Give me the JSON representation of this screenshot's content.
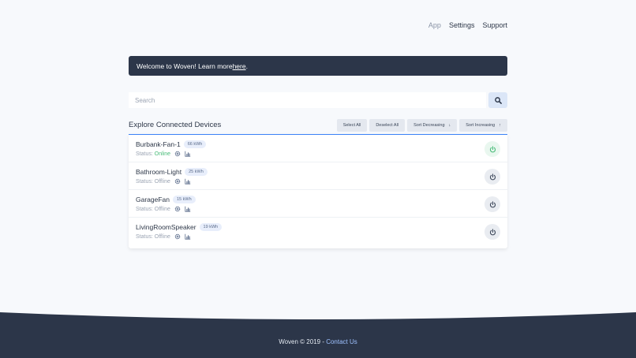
{
  "nav": {
    "app": "App",
    "settings": "Settings",
    "support": "Support"
  },
  "banner": {
    "text": "Welcome to Woven! Learn more ",
    "link": "here",
    "suffix": "."
  },
  "search": {
    "placeholder": "Search",
    "value": ""
  },
  "section": {
    "title": "Explore Connected Devices",
    "select_all": "Select All",
    "deselect_all": "Deselect All",
    "sort_decreasing": "Sort Decreasing",
    "sort_increasing": "Sort Increasing"
  },
  "devices": [
    {
      "name": "Burbank-Fan-1",
      "energy": "66 kWh",
      "status_label": "Status:",
      "status": "Online"
    },
    {
      "name": "Bathroom-Light",
      "energy": "25 kWh",
      "status_label": "Status:",
      "status": "Offline"
    },
    {
      "name": "GarageFan",
      "energy": "15 kWh",
      "status_label": "Status:",
      "status": "Offline"
    },
    {
      "name": "LivingRoomSpeaker",
      "energy": "19 kWh",
      "status_label": "Status:",
      "status": "Offline"
    }
  ],
  "footer": {
    "text": "Woven © 2019 - ",
    "link": "Contact Us"
  },
  "colors": {
    "navy": "#2c3649",
    "accent": "#3b82f6",
    "online": "#48bb78"
  }
}
